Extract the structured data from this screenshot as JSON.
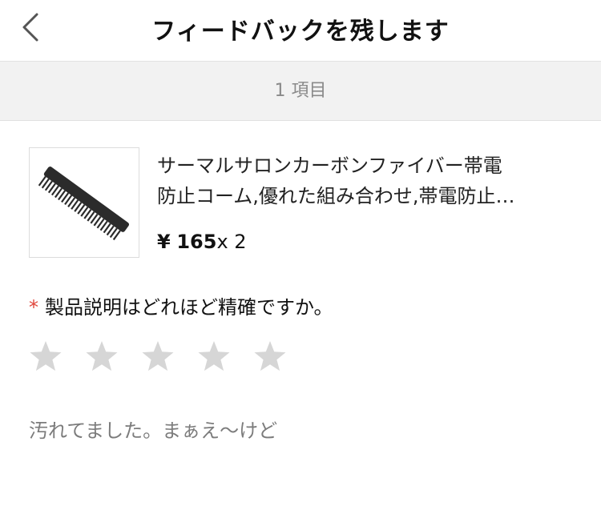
{
  "header": {
    "title": "フィードバックを残します",
    "back_icon": "chevron-left-icon"
  },
  "item_count": "1 項目",
  "product": {
    "name_line1": "サーマルサロンカーボンファイバー帯電",
    "name_line2": "防止コーム,優れた組み合わせ,帯電防止…",
    "currency": "¥",
    "price": "165",
    "quantity": "x 2",
    "image_icon": "comb-image"
  },
  "rating": {
    "required_mark": "*",
    "question": "製品説明はどれほど精確ですか。",
    "max_stars": 5,
    "selected_stars": 0,
    "star_icon": "star-icon"
  },
  "comment": {
    "text": "汚れてました。まぁえ〜けど"
  },
  "colors": {
    "required": "#e0463c",
    "star_empty": "#d6d6d6",
    "count_bar_bg": "#f2f2f2"
  }
}
